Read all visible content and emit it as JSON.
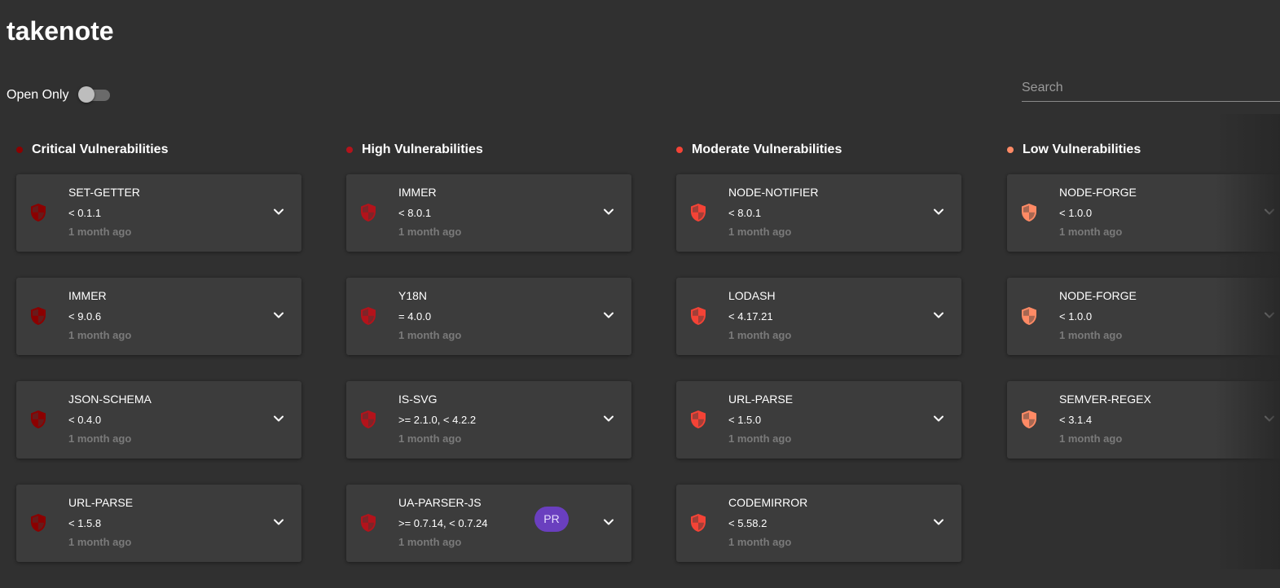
{
  "app": {
    "title": "takenote"
  },
  "filters": {
    "open_only_label": "Open Only",
    "open_only": false
  },
  "search": {
    "placeholder": "Search",
    "value": ""
  },
  "columns": [
    {
      "title": "Critical Vulnerabilities",
      "color": "#8b0000",
      "cards": [
        {
          "name": "SET-GETTER",
          "range": "< 0.1.1",
          "time": "1 month ago"
        },
        {
          "name": "IMMER",
          "range": "< 9.0.6",
          "time": "1 month ago"
        },
        {
          "name": "JSON-SCHEMA",
          "range": "< 0.4.0",
          "time": "1 month ago"
        },
        {
          "name": "URL-PARSE",
          "range": "< 1.5.8",
          "time": "1 month ago"
        }
      ]
    },
    {
      "title": "High Vulnerabilities",
      "color": "#b3131b",
      "cards": [
        {
          "name": "IMMER",
          "range": "< 8.0.1",
          "time": "1 month ago"
        },
        {
          "name": "Y18N",
          "range": "= 4.0.0",
          "time": "1 month ago"
        },
        {
          "name": "IS-SVG",
          "range": ">= 2.1.0, < 4.2.2",
          "time": "1 month ago"
        },
        {
          "name": "UA-PARSER-JS",
          "range": ">= 0.7.14, < 0.7.24",
          "time": "1 month ago",
          "badge": "PR"
        }
      ]
    },
    {
      "title": "Moderate Vulnerabilities",
      "color": "#f44336",
      "cards": [
        {
          "name": "NODE-NOTIFIER",
          "range": "< 8.0.1",
          "time": "1 month ago"
        },
        {
          "name": "LODASH",
          "range": "< 4.17.21",
          "time": "1 month ago"
        },
        {
          "name": "URL-PARSE",
          "range": "< 1.5.0",
          "time": "1 month ago"
        },
        {
          "name": "CODEMIRROR",
          "range": "< 5.58.2",
          "time": "1 month ago"
        }
      ]
    },
    {
      "title": "Low Vulnerabilities",
      "color": "#ff8a65",
      "cards": [
        {
          "name": "NODE-FORGE",
          "range": "< 1.0.0",
          "time": "1 month ago"
        },
        {
          "name": "NODE-FORGE",
          "range": "< 1.0.0",
          "time": "1 month ago"
        },
        {
          "name": "SEMVER-REGEX",
          "range": "< 3.1.4",
          "time": "1 month ago"
        }
      ]
    }
  ]
}
